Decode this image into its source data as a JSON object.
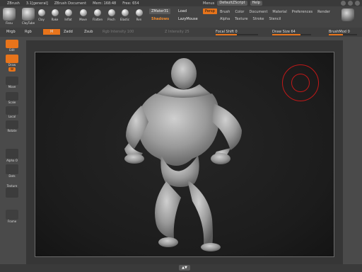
{
  "titlebar": {
    "app": "ZBrush",
    "version": "3.1[general]",
    "document": "ZBrush Document",
    "mem": "Mem: 168:48",
    "free": "Free: 654",
    "menus_label": "Menus",
    "script": "DefaultZScript",
    "help": "Help"
  },
  "shelf": {
    "tools": [
      {
        "label": "Fissu"
      },
      {
        "label": "ClayTube"
      }
    ],
    "brushes": [
      {
        "label": "Clay"
      },
      {
        "label": "Rake"
      },
      {
        "label": "Inflat"
      },
      {
        "label": "Move"
      },
      {
        "label": "Flatten"
      },
      {
        "label": "Pinch"
      },
      {
        "label": "Elastic"
      },
      {
        "label": "Ren"
      }
    ],
    "zmater": "ZMater31",
    "load": "Load",
    "shadows": "Shadows",
    "lazymouse": "LazyMouse",
    "persp": "Persp",
    "menu_row1": [
      "Brush",
      "Color",
      "Document",
      "Material",
      "Preferences",
      "Render"
    ],
    "menu_row2": [
      "Alpha",
      "Texture",
      "Stroke",
      "Stencil"
    ]
  },
  "shelf2": {
    "mrgb": "Mrgb",
    "rgb": "Rgb",
    "m": "M",
    "zadd": "Zadd",
    "zsub": "Zsub",
    "rgb_intensity": "Rgb Intensity 100",
    "z_intensity": "Z Intensity 25",
    "focal_shift": "Focal Shift 0",
    "draw_size": "Draw Size 64",
    "brush_mod": "BrushMod 0",
    "focal_shift_fill": 0.5,
    "draw_size_fill": 0.72,
    "brush_mod_fill": 0.5
  },
  "leftbar": {
    "items": [
      {
        "label": "Edit"
      },
      {
        "label": "Draw"
      },
      {
        "label": "W"
      },
      {
        "label": "Move"
      },
      {
        "label": "Scale"
      },
      {
        "label": "Local"
      },
      {
        "label": "Rotate"
      },
      {
        "label": "Alpha O"
      },
      {
        "label": "Dots"
      },
      {
        "label": "Texture"
      },
      {
        "label": "Frame"
      }
    ]
  },
  "colors": {
    "accent": "#e8741b",
    "cursor": "#c01818"
  }
}
